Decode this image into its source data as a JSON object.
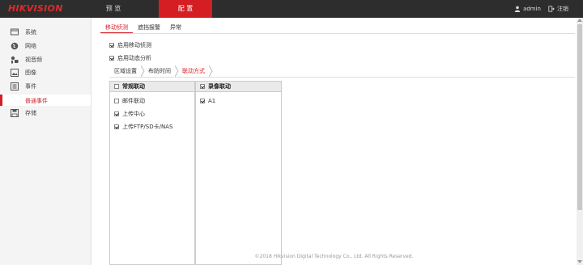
{
  "header": {
    "logo": "HIKVISION",
    "nav": [
      {
        "label": "预 览"
      },
      {
        "label": "配 置"
      }
    ],
    "user": "admin",
    "logout": "注销"
  },
  "sidebar": {
    "items": [
      {
        "label": "系统",
        "icon": "monitor-icon"
      },
      {
        "label": "网络",
        "icon": "globe-icon"
      },
      {
        "label": "视音频",
        "icon": "camera-mic-icon"
      },
      {
        "label": "图像",
        "icon": "image-icon"
      },
      {
        "label": "事件",
        "icon": "event-list-icon"
      },
      {
        "label": "存储",
        "icon": "save-disk-icon"
      }
    ],
    "active_sub": "普通事件"
  },
  "tabs": [
    {
      "label": "移动侦测",
      "active": true
    },
    {
      "label": "遮挡报警",
      "active": false
    },
    {
      "label": "异常",
      "active": false
    }
  ],
  "options": {
    "enable_motion": {
      "label": "启用移动侦测",
      "checked": true
    },
    "enable_dynamic": {
      "label": "启用动态分析",
      "checked": true
    }
  },
  "subtabs": [
    {
      "label": "区域设置",
      "active": false
    },
    {
      "label": "布防时间",
      "active": false
    },
    {
      "label": "联动方式",
      "active": true
    }
  ],
  "linkage": {
    "normal": {
      "title": "常规联动",
      "title_checked": false,
      "rows": [
        {
          "label": "邮件联动",
          "checked": false
        },
        {
          "label": "上传中心",
          "checked": true
        },
        {
          "label": "上传FTP/SD卡/NAS",
          "checked": true
        }
      ]
    },
    "record": {
      "title": "录像联动",
      "title_checked": true,
      "rows": [
        {
          "label": "A1",
          "checked": true
        }
      ]
    }
  },
  "footer": "©2018 Hikvision Digital Technology Co., Ltd. All Rights Reserved.",
  "colors": {
    "accent": "#d41e24",
    "topbar": "#2d2d2d"
  }
}
